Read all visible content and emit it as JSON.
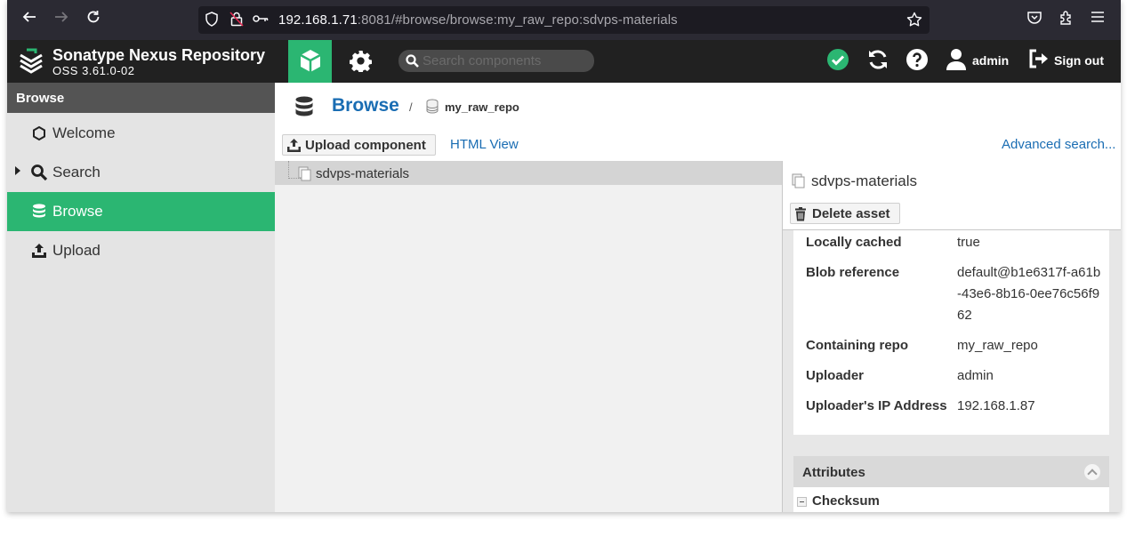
{
  "browser": {
    "url_host": "192.168.1.71",
    "url_rest": ":8081/#browse/browse:my_raw_repo:sdvps-materials"
  },
  "header": {
    "brand_title": "Sonatype Nexus Repository",
    "brand_version": "OSS 3.61.0-02",
    "search_placeholder": "Search components",
    "username": "admin",
    "signout_label": "Sign out",
    "accent_color": "#2bb672",
    "status_color": "#2bb672"
  },
  "sidebar": {
    "title": "Browse",
    "items": [
      {
        "label": "Welcome",
        "icon": "hexagon-icon"
      },
      {
        "label": "Search",
        "icon": "search-icon"
      },
      {
        "label": "Browse",
        "icon": "database-icon"
      },
      {
        "label": "Upload",
        "icon": "upload-icon"
      }
    ]
  },
  "main": {
    "breadcrumb_title": "Browse",
    "breadcrumb_separator": "/",
    "breadcrumb_repo": "my_raw_repo",
    "upload_button": "Upload component",
    "html_view_link": "HTML View",
    "advanced_search_link": "Advanced search...",
    "tree": [
      {
        "label": "sdvps-materials"
      }
    ]
  },
  "detail": {
    "title": "sdvps-materials",
    "delete_button": "Delete asset",
    "fields": [
      {
        "key": "Locally cached",
        "value": "true"
      },
      {
        "key": "Blob reference",
        "value": "default@b1e6317f-a61b-43e6-8b16-0ee76c56f962"
      },
      {
        "key": "Containing repo",
        "value": "my_raw_repo"
      },
      {
        "key": "Uploader",
        "value": "admin"
      },
      {
        "key": "Uploader's IP Address",
        "value": "192.168.1.87"
      }
    ],
    "attributes_label": "Attributes",
    "checksum_label": "Checksum"
  }
}
